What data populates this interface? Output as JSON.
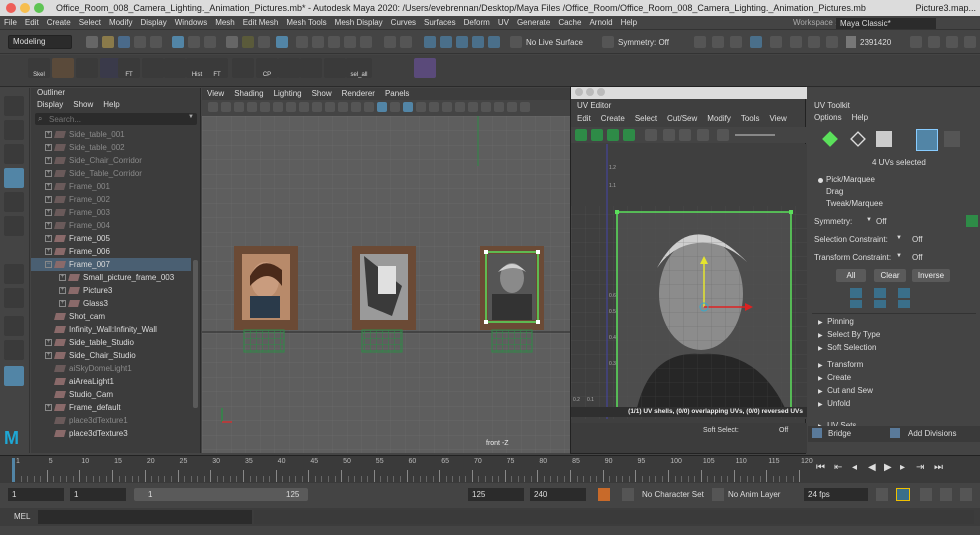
{
  "title": "Office_Room_008_Camera_Lighting._Animation_Pictures.mb* - Autodesk Maya 2020: /Users/evebrennan/Desktop/Maya Files /Office_Room/Office_Room_008_Camera_Lighting._Animation_Pictures.mb",
  "title_right": "Picture3.map...",
  "menu": [
    "File",
    "Edit",
    "Create",
    "Select",
    "Modify",
    "Display",
    "Windows",
    "Mesh",
    "Edit Mesh",
    "Mesh Tools",
    "Mesh Display",
    "Curves",
    "Surfaces",
    "Deform",
    "UV",
    "Generate",
    "Cache",
    "Arnold",
    "Help"
  ],
  "workspace": {
    "label": "Workspace :",
    "value": "Maya Classic*"
  },
  "status": {
    "mode": "Modeling",
    "live_surface": "No Live Surface",
    "symmetry": "Symmetry: Off",
    "count": "2391420"
  },
  "shelf": [
    {
      "label": "Skel"
    },
    {
      "label": ""
    },
    {
      "label": ""
    },
    {
      "label": "FT"
    },
    {
      "label": ""
    },
    {
      "label": ""
    },
    {
      "label": "Hist"
    },
    {
      "label": "FT"
    },
    {
      "label": ""
    },
    {
      "label": "CP"
    },
    {
      "label": ""
    },
    {
      "label": ""
    },
    {
      "label": ""
    },
    {
      "label": "sel_all"
    },
    {
      "label": ""
    }
  ],
  "outliner": {
    "title": "Outliner",
    "menu": [
      "Display",
      "Show",
      "Help"
    ],
    "search_placeholder": "Search...",
    "items": [
      {
        "label": "Side_table_001",
        "dim": true,
        "indent": 0,
        "plus": true
      },
      {
        "label": "Side_table_002",
        "dim": true,
        "indent": 0,
        "plus": true
      },
      {
        "label": "Side_Chair_Corridor",
        "dim": true,
        "indent": 0,
        "plus": true
      },
      {
        "label": "Side_Table_Corridor",
        "dim": true,
        "indent": 0,
        "plus": true
      },
      {
        "label": "Frame_001",
        "dim": true,
        "indent": 0,
        "plus": true
      },
      {
        "label": "Frame_002",
        "dim": true,
        "indent": 0,
        "plus": true
      },
      {
        "label": "Frame_003",
        "dim": true,
        "indent": 0,
        "plus": true
      },
      {
        "label": "Frame_004",
        "dim": true,
        "indent": 0,
        "plus": true
      },
      {
        "label": "Frame_005",
        "dim": false,
        "indent": 0,
        "plus": true
      },
      {
        "label": "Frame_006",
        "dim": false,
        "indent": 0,
        "plus": true
      },
      {
        "label": "Frame_007",
        "dim": false,
        "indent": 0,
        "plus": true,
        "selected": true
      },
      {
        "label": "Small_picture_frame_003",
        "dim": false,
        "indent": 1,
        "plus": true
      },
      {
        "label": "Picture3",
        "dim": false,
        "indent": 1,
        "plus": true
      },
      {
        "label": "Glass3",
        "dim": false,
        "indent": 1,
        "plus": true
      },
      {
        "label": "Shot_cam",
        "dim": false,
        "indent": 0,
        "plus": false
      },
      {
        "label": "Infinity_Wall:Infinity_Wall",
        "dim": false,
        "indent": 0,
        "plus": false
      },
      {
        "label": "Side_table_Studio",
        "dim": false,
        "indent": 0,
        "plus": true
      },
      {
        "label": "Side_Chair_Studio",
        "dim": false,
        "indent": 0,
        "plus": true
      },
      {
        "label": "aiSkyDomeLight1",
        "dim": true,
        "indent": 0,
        "plus": false
      },
      {
        "label": "aiAreaLight1",
        "dim": false,
        "indent": 0,
        "plus": false
      },
      {
        "label": "Studio_Cam",
        "dim": false,
        "indent": 0,
        "plus": false
      },
      {
        "label": "Frame_default",
        "dim": false,
        "indent": 0,
        "plus": true
      },
      {
        "label": "place3dTexture1",
        "dim": true,
        "indent": 0,
        "plus": false
      },
      {
        "label": "place3dTexture3",
        "dim": false,
        "indent": 0,
        "plus": false
      }
    ]
  },
  "viewport": {
    "menu": [
      "View",
      "Shading",
      "Lighting",
      "Show",
      "Renderer",
      "Panels"
    ],
    "camera_label": "front -Z",
    "soft_select_label": "Soft Select:",
    "soft_select_value": "Off"
  },
  "uv_editor": {
    "title": "UV Editor",
    "menu": [
      "Edit",
      "Create",
      "Select",
      "Cut/Sew",
      "Modify",
      "Tools",
      "View"
    ],
    "status": "(1/1) UV shells, (0/0) overlapping UVs, (0/0) reversed UVs",
    "ticks": [
      "1.2",
      "1.1",
      "0.6",
      "0.5",
      "0.4",
      "0.3"
    ],
    "bottom_ticks": [
      "0.2",
      "0.1"
    ]
  },
  "uv_toolkit": {
    "title": "UV Toolkit",
    "menu": [
      "Options",
      "Help"
    ],
    "selected_text": "4 UVs selected",
    "modes": [
      "Pick/Marquee",
      "Drag",
      "Tweak/Marquee"
    ],
    "symmetry_label": "Symmetry:",
    "symmetry_value": "Off",
    "sel_constraint_label": "Selection Constraint:",
    "sel_constraint_value": "Off",
    "xf_constraint_label": "Transform Constraint:",
    "xf_constraint_value": "Off",
    "buttons": [
      "All",
      "Clear",
      "Inverse"
    ],
    "sections": [
      "Pinning",
      "Select By Type",
      "Soft Selection",
      "Transform",
      "Create",
      "Cut and Sew",
      "Unfold",
      "UV Sets"
    ],
    "bottom_buttons": [
      "Bridge",
      "Add Divisions"
    ]
  },
  "timeline": {
    "ticks": [
      "1",
      "5",
      "10",
      "15",
      "20",
      "25",
      "30",
      "35",
      "40",
      "45",
      "50",
      "55",
      "60",
      "65",
      "70",
      "75",
      "80",
      "85",
      "90",
      "95",
      "100",
      "105",
      "110",
      "115",
      "120"
    ],
    "current": "1"
  },
  "range": {
    "start": "1",
    "start2": "1",
    "slider_start": "1",
    "slider_end": "125",
    "end": "125",
    "anim_end": "240",
    "character_set": "No Character Set",
    "anim_layer": "No Anim Layer",
    "fps": "24 fps"
  },
  "cmd": {
    "label": "MEL"
  },
  "colors": {
    "accent": "#5285a6",
    "selection": "#4a5f72",
    "uv_green": "#5be05b",
    "frame_brown": "#6b4a35"
  }
}
